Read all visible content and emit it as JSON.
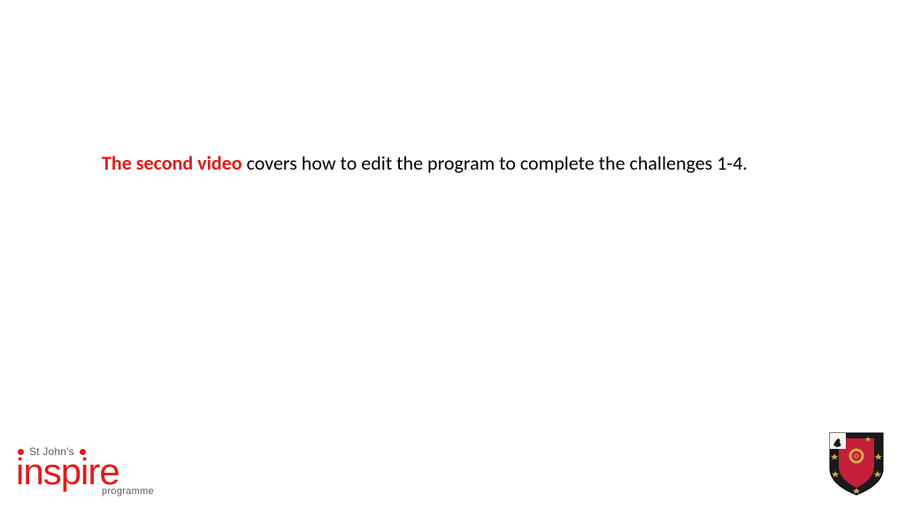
{
  "content": {
    "highlight": "The second video",
    "body": " covers how to edit the program to complete the challenges 1-4."
  },
  "logo": {
    "top_label": "St John's",
    "main": "inspire",
    "sub": "programme"
  },
  "colors": {
    "accent_red": "#e11b1b",
    "text_black": "#000000",
    "text_grey": "#5a5a5a",
    "shield_red": "#c41e3a",
    "shield_black": "#1a1a1a",
    "shield_gold": "#d4a849"
  }
}
